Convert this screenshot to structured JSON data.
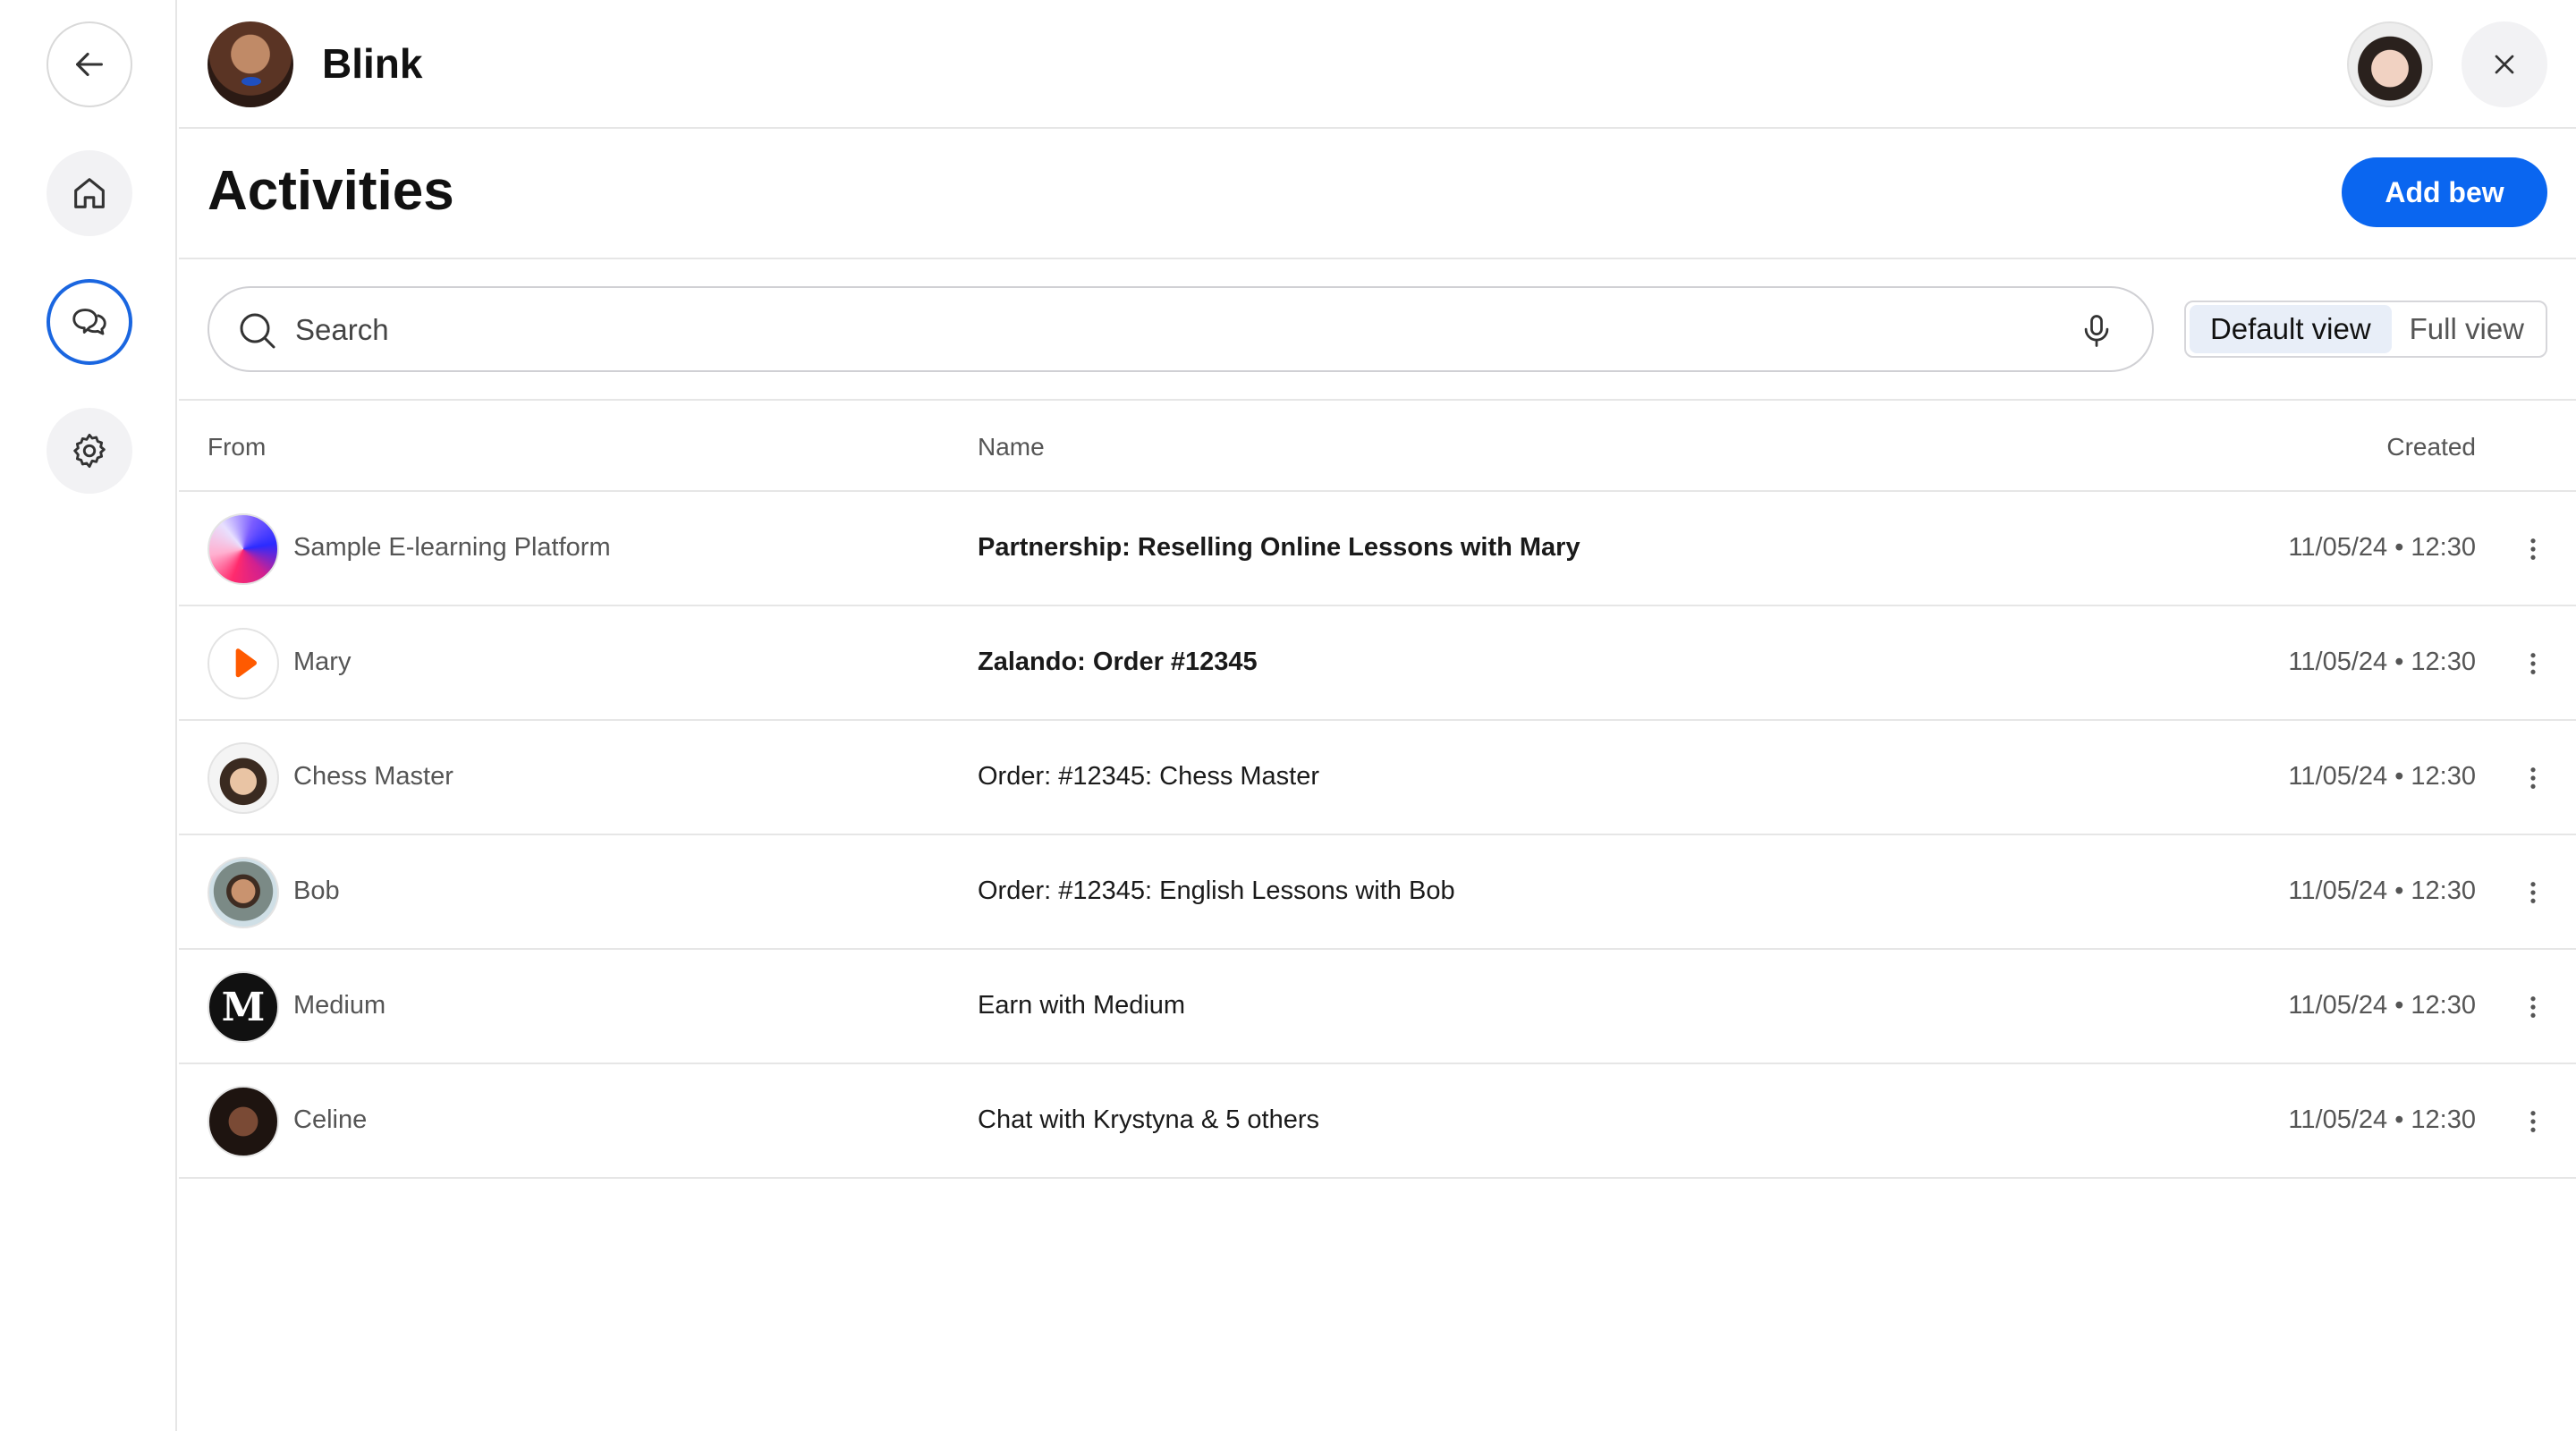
{
  "header": {
    "brand_name": "Blink"
  },
  "page": {
    "title": "Activities",
    "add_button_label": "Add bew"
  },
  "search": {
    "placeholder": "Search"
  },
  "view_toggle": {
    "default_label": "Default view",
    "full_label": "Full view",
    "selected": "Default view"
  },
  "table": {
    "columns": {
      "from": "From",
      "name": "Name",
      "created": "Created"
    },
    "rows": [
      {
        "from": "Sample E-learning Platform",
        "name": "Partnership: Reselling Online Lessons with Mary",
        "created": "11/05/24 • 12:30",
        "unread": true
      },
      {
        "from": "Mary",
        "name": "Zalando: Order #12345",
        "created": "11/05/24 • 12:30",
        "unread": true
      },
      {
        "from": "Chess Master",
        "name": "Order: #12345: Chess Master",
        "created": "11/05/24 • 12:30",
        "unread": false
      },
      {
        "from": "Bob",
        "name": "Order: #12345: English Lessons with Bob",
        "created": "11/05/24 • 12:30",
        "unread": false
      },
      {
        "from": "Medium",
        "name": "Earn with Medium",
        "created": "11/05/24 • 12:30",
        "unread": false
      },
      {
        "from": "Celine",
        "name": "Chat with Krystyna & 5 others",
        "created": "11/05/24 • 12:30",
        "unread": false
      }
    ]
  },
  "icons": {
    "back": "arrow-left-icon",
    "home": "home-icon",
    "chat": "chat-bubbles-icon",
    "settings": "gear-icon",
    "close": "close-icon",
    "search": "search-icon",
    "mic": "microphone-icon",
    "row_menu": "kebab-menu-icon"
  },
  "colors": {
    "accent": "#0a66f0",
    "active_rail": "#1a66e0"
  }
}
